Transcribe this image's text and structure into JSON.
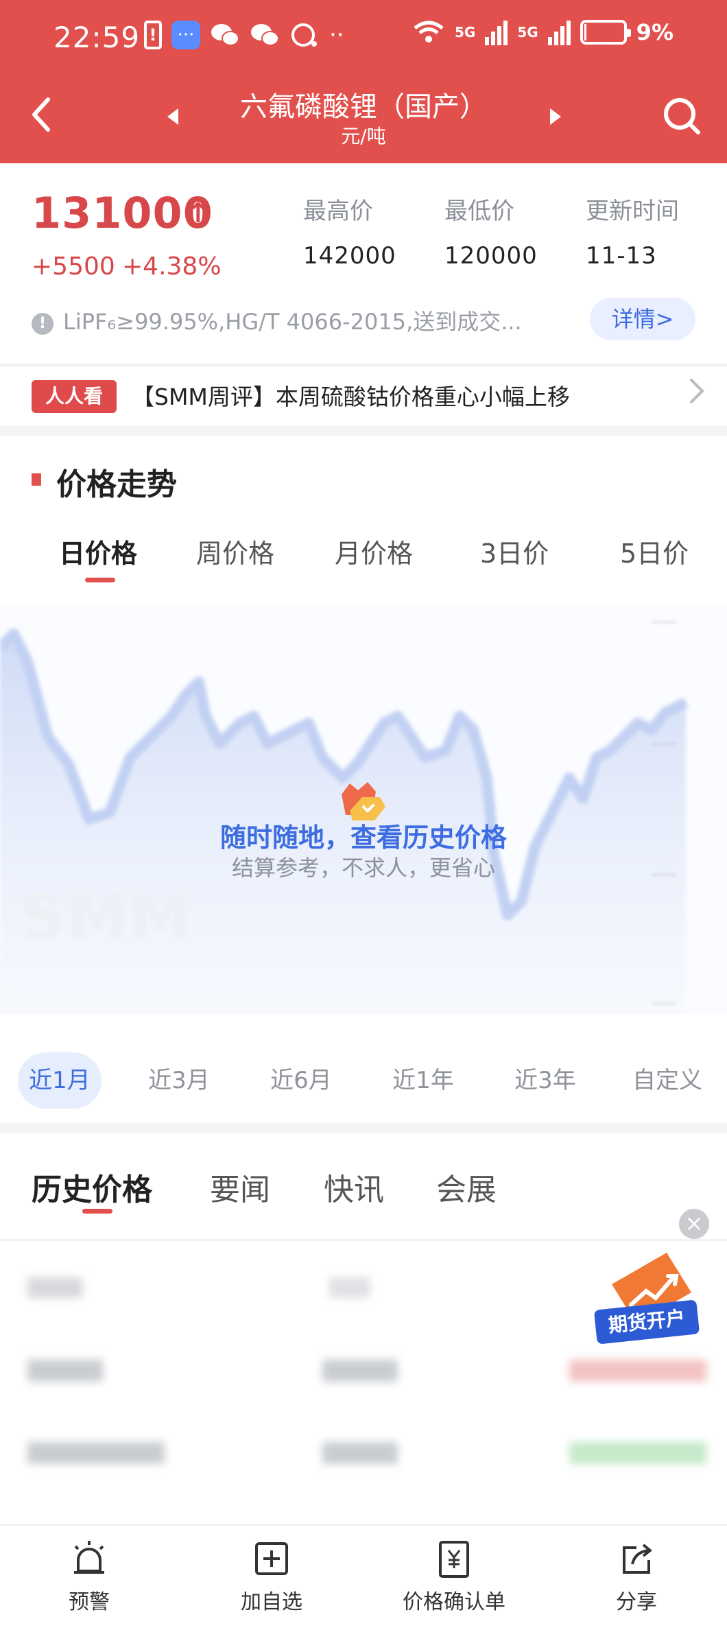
{
  "status_bar": {
    "time": "22:59",
    "network_1": "5G",
    "network_2": "5G",
    "battery": "9%"
  },
  "nav": {
    "title": "六氟磷酸锂（国产）",
    "unit": "元/吨"
  },
  "price": {
    "current": "131000",
    "change": "+5500",
    "change_pct": "+4.38%",
    "stats": [
      {
        "label": "最高价",
        "value": "142000"
      },
      {
        "label": "最低价",
        "value": "120000"
      },
      {
        "label": "更新时间",
        "value": "11-13"
      }
    ],
    "spec": "LiPF₆≥99.95%,HG/T 4066-2015,送到成交...",
    "detail_button": "详情>",
    "up_color": "#d8474a"
  },
  "news": {
    "badge": "人人看",
    "headline": "【SMM周评】本周硫酸钴价格重心小幅上移"
  },
  "trend": {
    "section_title": "价格走势",
    "tabs": [
      "日价格",
      "周价格",
      "月价格",
      "3日价",
      "5日价"
    ],
    "active_tab": "日价格",
    "watermark": "SMM",
    "promo_title": "随时随地，查看历史价格",
    "promo_subtitle": "结算参考，不求人，更省心",
    "ranges": [
      "近1月",
      "近3月",
      "近6月",
      "近1年",
      "近3年",
      "自定义"
    ],
    "active_range": "近1月"
  },
  "history": {
    "tabs": [
      "历史价格",
      "要闻",
      "快讯",
      "会展"
    ],
    "active_tab": "历史价格",
    "ad_label": "期货开户"
  },
  "bottom_bar": [
    {
      "label": "预警",
      "icon": "alarm-icon"
    },
    {
      "label": "加自选",
      "icon": "add-watchlist-icon"
    },
    {
      "label": "价格确认单",
      "icon": "price-confirm-icon"
    },
    {
      "label": "分享",
      "icon": "share-icon"
    }
  ],
  "colors": {
    "header": "#e2504d",
    "accent_blue": "#3d6de0",
    "up_red": "#d8474a"
  }
}
